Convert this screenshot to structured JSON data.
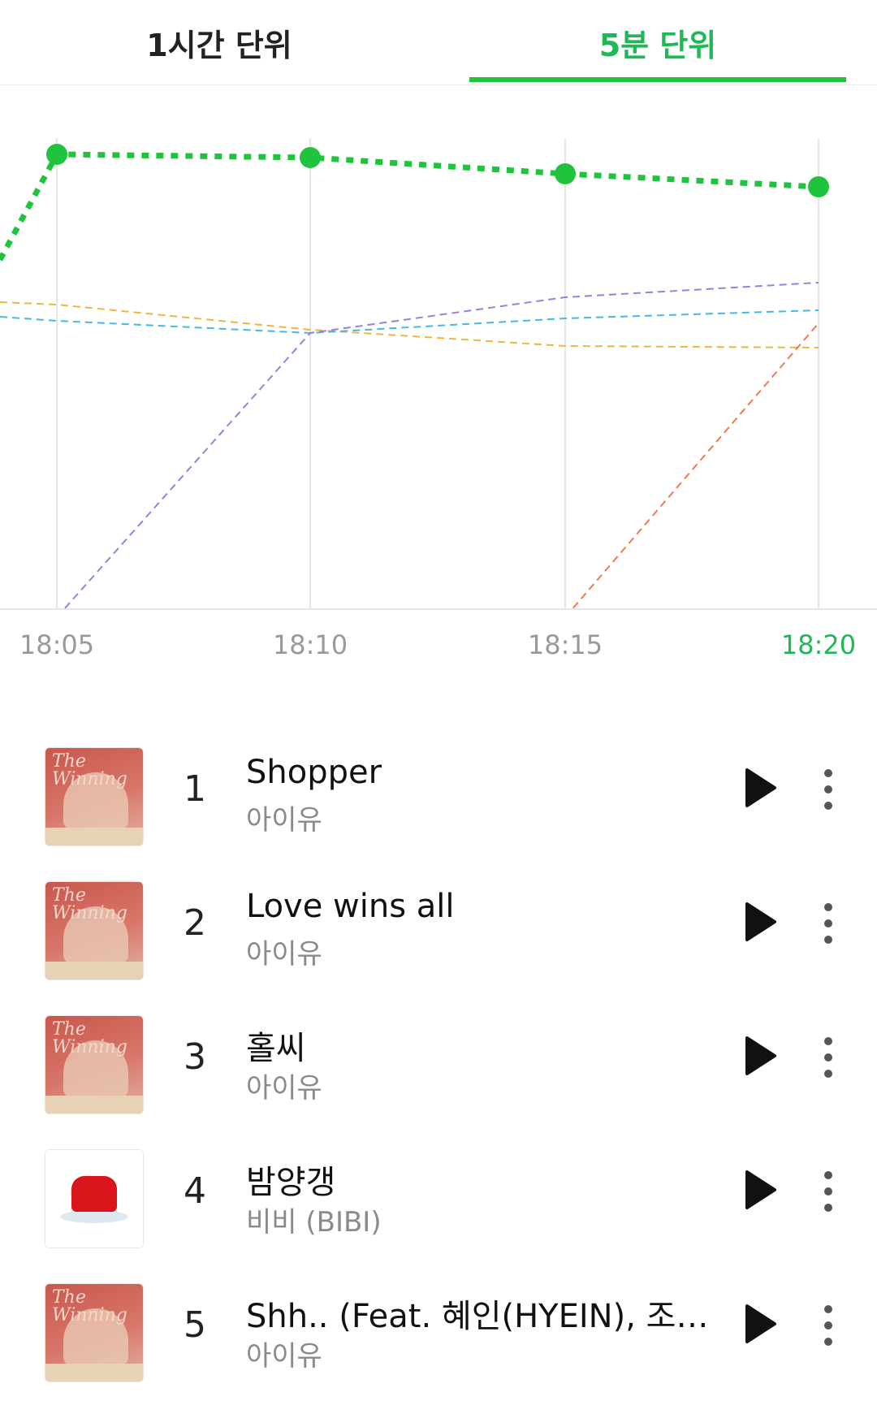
{
  "tabs": {
    "hourly": "1시간 단위",
    "five_min": "5분 단위",
    "selected": "5분 단위"
  },
  "colors": {
    "accent": "#1fc43c",
    "series_orange": "#f0b63a",
    "series_blue": "#45b8e6",
    "series_purple": "#9b7fe0",
    "series_red": "#f07a4e"
  },
  "chart_data": {
    "type": "line",
    "x": [
      "18:05",
      "18:10",
      "18:15",
      "18:20"
    ],
    "highlight_x": "18:20",
    "series": [
      {
        "values": [
          1,
          1,
          1,
          1
        ],
        "color": "#1fc43c",
        "style": "dotted-thick-with-markers"
      },
      {
        "values": [
          3,
          4,
          4,
          5
        ],
        "color": "#f0b63a",
        "style": "dashed"
      },
      {
        "values": [
          4,
          5,
          3,
          3
        ],
        "color": "#45b8e6",
        "style": "dashed"
      },
      {
        "values": [
          14,
          6,
          4,
          4
        ],
        "color": "#9b7fe0",
        "style": "dashed"
      },
      {
        "values": [
          null,
          null,
          14,
          6
        ],
        "color": "#f07a4e",
        "style": "dashed"
      }
    ],
    "grid": "vertical",
    "y_axis": "rank (reversed, hidden)"
  },
  "list": [
    {
      "rank": "1",
      "title": "Shopper",
      "artist": "아이유",
      "cover": "winning"
    },
    {
      "rank": "2",
      "title": "Love wins all",
      "artist": "아이유",
      "cover": "winning"
    },
    {
      "rank": "3",
      "title": "홀씨",
      "artist": "아이유",
      "cover": "winning"
    },
    {
      "rank": "4",
      "title": "밤양갱",
      "artist": "비비 (BIBI)",
      "cover": "jelly"
    },
    {
      "rank": "5",
      "title": "Shh.. (Feat. 혜인(HYEIN), 조원…",
      "artist": "아이유",
      "cover": "winning"
    }
  ],
  "cover_text": {
    "winning": "The Winning"
  },
  "icons": {
    "play": "play-icon",
    "more": "more-vertical-icon"
  }
}
